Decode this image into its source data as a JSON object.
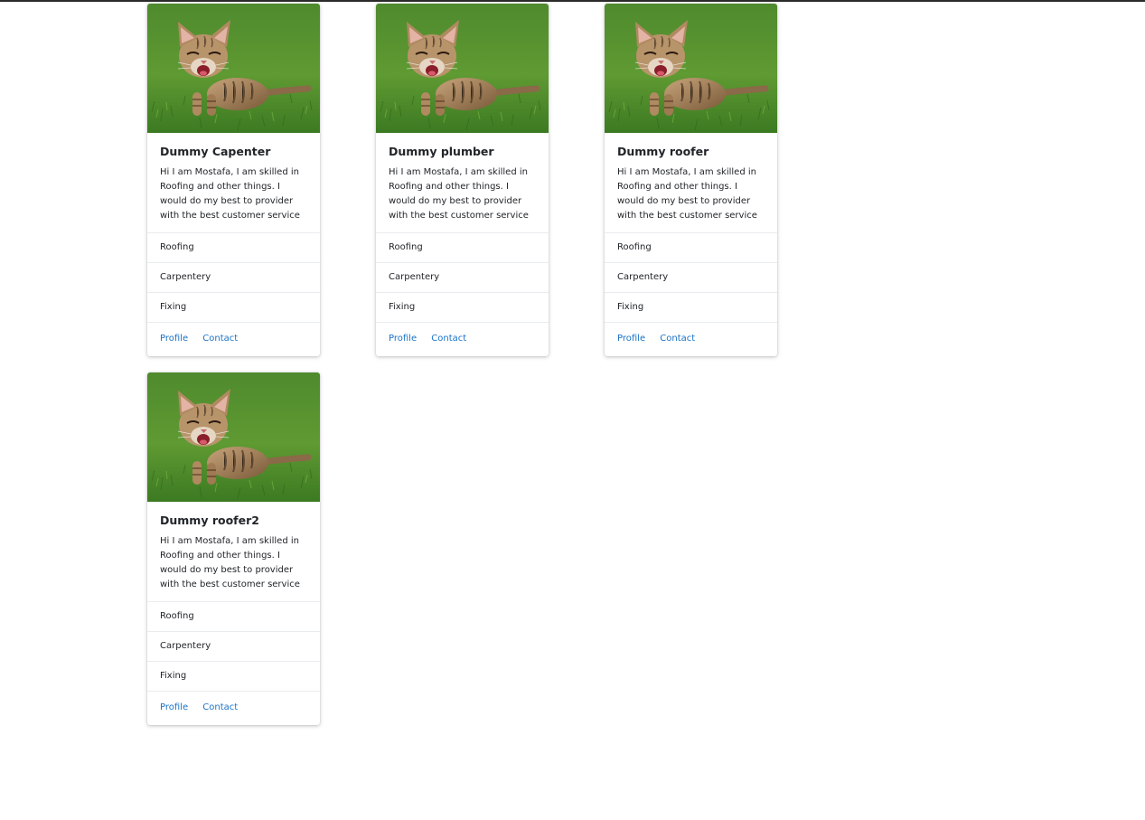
{
  "cards": [
    {
      "title": "Dummy Capenter",
      "text": "Hi I am Mostafa, I am skilled in Roofing and other things. I would do my best to provider with the best customer service",
      "skills": [
        "Roofing",
        "Carpentery",
        "Fixing"
      ],
      "profile_label": "Profile",
      "contact_label": "Contact"
    },
    {
      "title": "Dummy plumber",
      "text": "Hi I am Mostafa, I am skilled in Roofing and other things. I would do my best to provider with the best customer service",
      "skills": [
        "Roofing",
        "Carpentery",
        "Fixing"
      ],
      "profile_label": "Profile",
      "contact_label": "Contact"
    },
    {
      "title": "Dummy roofer",
      "text": "Hi I am Mostafa, I am skilled in Roofing and other things. I would do my best to provider with the best customer service",
      "skills": [
        "Roofing",
        "Carpentery",
        "Fixing"
      ],
      "profile_label": "Profile",
      "contact_label": "Contact"
    },
    {
      "title": "Dummy roofer2",
      "text": "Hi I am Mostafa, I am skilled in Roofing and other things. I would do my best to provider with the best customer service",
      "skills": [
        "Roofing",
        "Carpentery",
        "Fixing"
      ],
      "profile_label": "Profile",
      "contact_label": "Contact"
    }
  ],
  "colors": {
    "link": "#1a73c6",
    "grass": "#4a8a2a",
    "kitten": "#a07a4e"
  }
}
